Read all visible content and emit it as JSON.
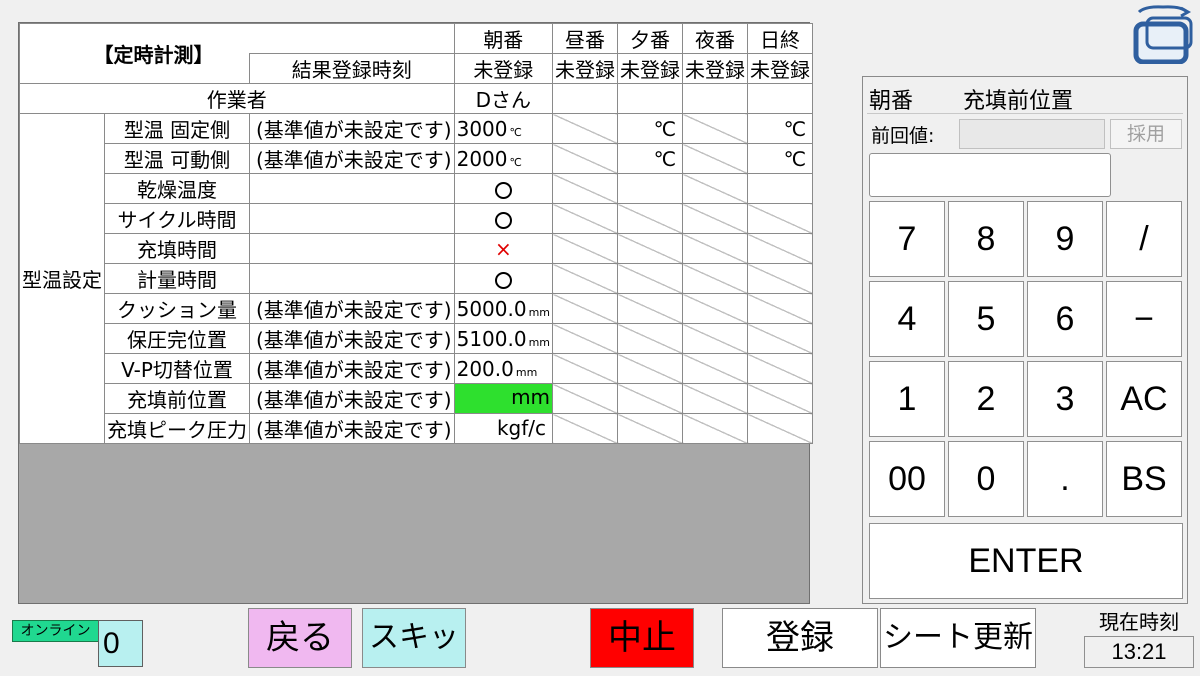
{
  "table": {
    "title": "【定時計測】",
    "result_time_label": "結果登録時刻",
    "shifts": [
      "朝番",
      "昼番",
      "夕番",
      "夜番",
      "日終"
    ],
    "statuses": [
      "未登録",
      "未登録",
      "未登録",
      "未登録",
      "未登録"
    ],
    "worker_label": "作業者",
    "worker_value": "Dさん",
    "section_label": "型温設定",
    "unset_note": "(基準値が未設定です)",
    "unit_c": "℃",
    "unit_mm": "mm",
    "unit_kgf": "kgf/c",
    "rows": {
      "mold_fixed": {
        "label": "型温 固定側",
        "value": "3000"
      },
      "mold_moving": {
        "label": "型温 可動側",
        "value": "2000"
      },
      "dry_temp": {
        "label": "乾燥温度"
      },
      "cycle_time": {
        "label": "サイクル時間"
      },
      "fill_time": {
        "label": "充填時間",
        "mark": "×"
      },
      "meter_time": {
        "label": "計量時間"
      },
      "cushion": {
        "label": "クッション量",
        "value": "5000.0"
      },
      "hold_pos": {
        "label": "保圧完位置",
        "value": "5100.0"
      },
      "vp_switch": {
        "label": "V-P切替位置",
        "value": "200.0"
      },
      "pre_fill_pos": {
        "label": "充填前位置"
      },
      "fill_peak": {
        "label": "充填ピーク圧力"
      }
    }
  },
  "keypad": {
    "shift": "朝番",
    "field": "充填前位置",
    "prev_label": "前回値:",
    "adopt": "採用",
    "keys": [
      "7",
      "8",
      "9",
      "/",
      "4",
      "5",
      "6",
      "−",
      "1",
      "2",
      "3",
      "AC",
      "00",
      "0",
      ".",
      "BS"
    ],
    "enter": "ENTER"
  },
  "footer": {
    "online_label": "オンライン",
    "online_count": "0",
    "back": "戻る",
    "skip": "スキップ",
    "stop": "中止",
    "register": "登録",
    "sheet_update": "シート更新",
    "clock_label": "現在時刻",
    "clock_value": "13:21"
  },
  "colors": {
    "skip_bg": "#b8f0f0",
    "back_bg": "#f0b8f0",
    "stop_bg": "#ff0000",
    "selected_cell": "#2ee02e",
    "online_badge": "#20d890"
  }
}
